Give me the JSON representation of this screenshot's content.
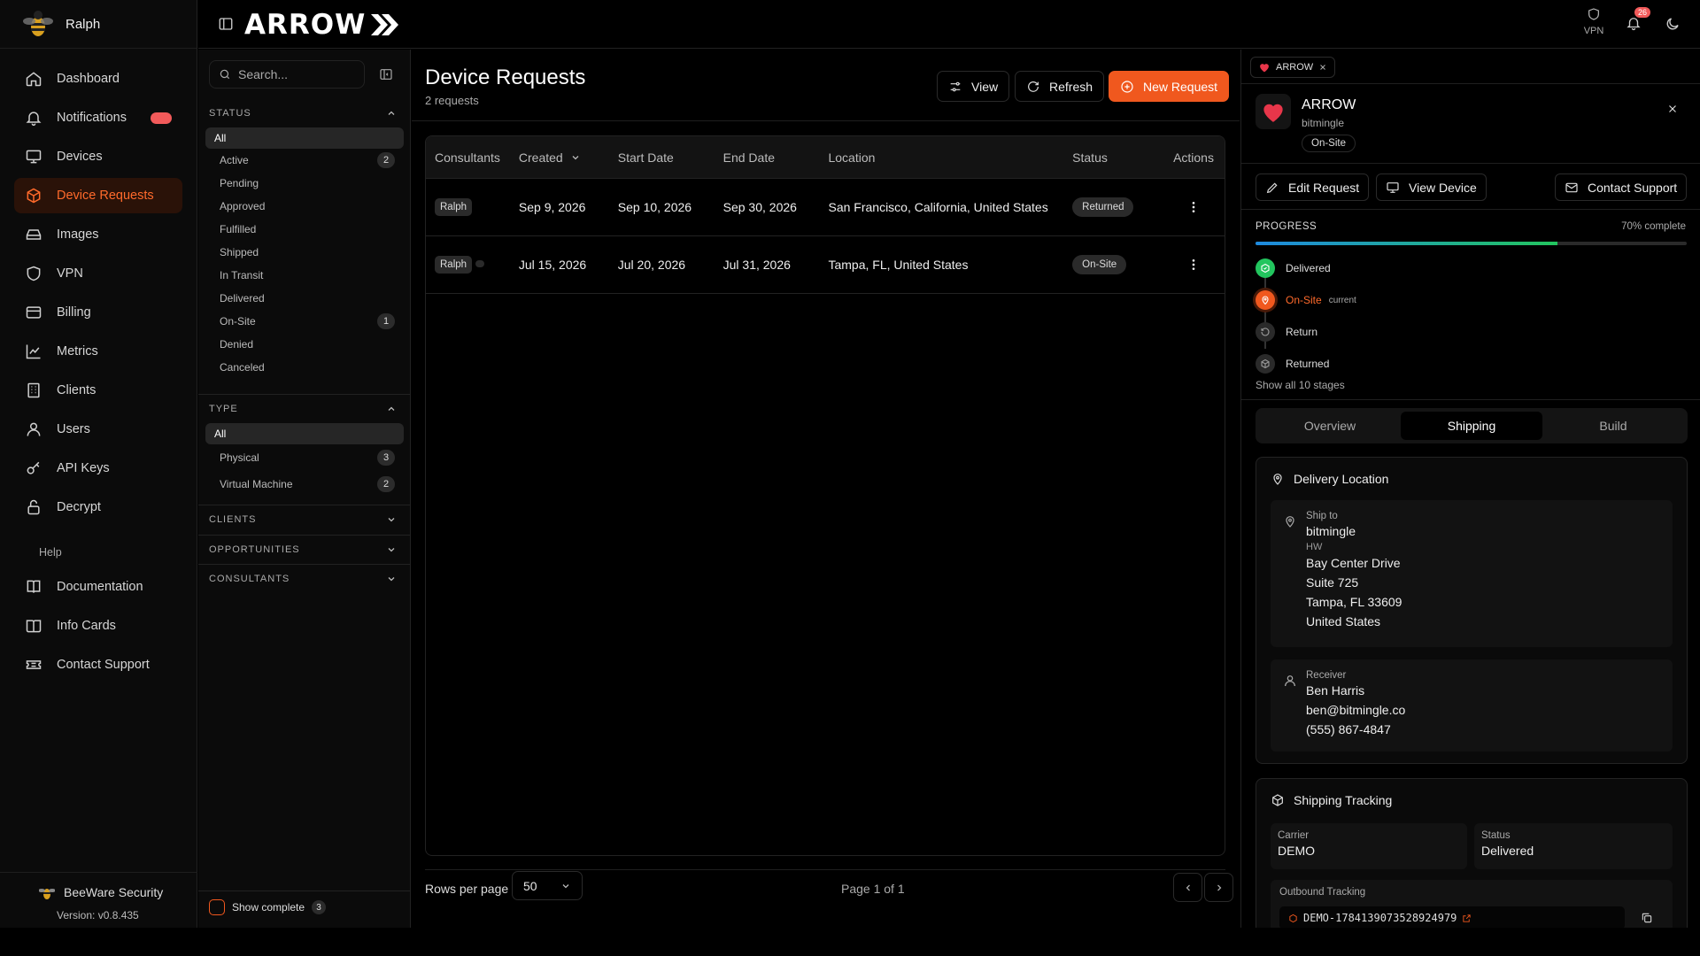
{
  "sidebar": {
    "user": "Ralph",
    "items": [
      {
        "label": "Dashboard"
      },
      {
        "label": "Notifications"
      },
      {
        "label": "Devices"
      },
      {
        "label": "Device Requests"
      },
      {
        "label": "Images"
      },
      {
        "label": "VPN"
      },
      {
        "label": "Billing"
      },
      {
        "label": "Metrics"
      },
      {
        "label": "Clients"
      },
      {
        "label": "Users"
      },
      {
        "label": "API Keys"
      },
      {
        "label": "Decrypt"
      }
    ],
    "help_heading": "Help",
    "help_items": [
      {
        "label": "Documentation"
      },
      {
        "label": "Info Cards"
      },
      {
        "label": "Contact Support"
      }
    ],
    "brand": "BeeWare Security",
    "version": "Version: v0.8.435"
  },
  "topbar": {
    "logo": "ARROW",
    "vpn_label": "VPN",
    "notif_count": "26"
  },
  "filters": {
    "search_placeholder": "Search...",
    "status": {
      "heading": "STATUS",
      "options": [
        {
          "label": "All",
          "count": ""
        },
        {
          "label": "Active",
          "count": "2"
        },
        {
          "label": "Pending",
          "count": ""
        },
        {
          "label": "Approved",
          "count": ""
        },
        {
          "label": "Fulfilled",
          "count": ""
        },
        {
          "label": "Shipped",
          "count": ""
        },
        {
          "label": "In Transit",
          "count": ""
        },
        {
          "label": "Delivered",
          "count": ""
        },
        {
          "label": "On-Site",
          "count": "1"
        },
        {
          "label": "Denied",
          "count": ""
        },
        {
          "label": "Canceled",
          "count": ""
        }
      ]
    },
    "type": {
      "heading": "TYPE",
      "options": [
        {
          "label": "All",
          "count": ""
        },
        {
          "label": "Physical",
          "count": "3"
        },
        {
          "label": "Virtual Machine",
          "count": "2"
        }
      ]
    },
    "clients_heading": "CLIENTS",
    "opportunities_heading": "OPPORTUNITIES",
    "consultants_heading": "CONSULTANTS",
    "show_complete": "Show complete",
    "show_complete_count": "3"
  },
  "main": {
    "title": "Device Requests",
    "subtitle": "2 requests",
    "view_label": "View",
    "refresh_label": "Refresh",
    "new_label": "New Request",
    "columns": [
      "Consultants",
      "Created",
      "Start Date",
      "End Date",
      "Location",
      "Status",
      "Actions"
    ],
    "rows": [
      {
        "consultant": "Ralph",
        "created": "Sep 9, 2026",
        "start": "Sep 10, 2026",
        "end": "Sep 30, 2026",
        "location": "San Francisco, California, United States",
        "status": "Returned"
      },
      {
        "consultant": "Ralph",
        "created": "Jul 15, 2026",
        "start": "Jul 20, 2026",
        "end": "Jul 31, 2026",
        "location": "Tampa, FL, United States",
        "status": "On-Site"
      }
    ],
    "rows_per_page_label": "Rows per page",
    "rows_per_page": "50",
    "page_info": "Page 1 of 1"
  },
  "panel": {
    "tab_label": "ARROW",
    "name": "ARROW",
    "client": "bitmingle",
    "state": "On-Site",
    "edit_label": "Edit Request",
    "view_device_label": "View Device",
    "contact_label": "Contact Support",
    "progress_label": "PROGRESS",
    "progress_text": "70% complete",
    "progress_value": 0.7,
    "stages": [
      {
        "name": "Delivered",
        "state": "done"
      },
      {
        "name": "On-Site",
        "state": "current",
        "tag": "current"
      },
      {
        "name": "Return",
        "state": "todo"
      },
      {
        "name": "Returned",
        "state": "todo"
      }
    ],
    "show_all": "Show all 10 stages",
    "tabs": [
      "Overview",
      "Shipping",
      "Build"
    ],
    "delivery": {
      "heading": "Delivery Location",
      "ship_to_label": "Ship to",
      "ship_to": "bitmingle",
      "dept": "HW",
      "addr1": "Bay Center Drive",
      "addr2": "Suite 725",
      "addr3": "Tampa, FL 33609",
      "addr4": "United States",
      "receiver_label": "Receiver",
      "receiver_name": "Ben Harris",
      "receiver_email": "ben@bitmingle.co",
      "receiver_phone": "(555) 867-4847"
    },
    "tracking": {
      "heading": "Shipping Tracking",
      "carrier_label": "Carrier",
      "carrier": "DEMO",
      "status_label": "Status",
      "status": "Delivered",
      "outbound_label": "Outbound Tracking",
      "outbound": "DEMO-1784139073528924979"
    }
  },
  "colors": {
    "accent": "#f0581e",
    "progress_start": "#1e8ae0",
    "progress_end": "#22c55e",
    "badge": "#f25a5a"
  }
}
